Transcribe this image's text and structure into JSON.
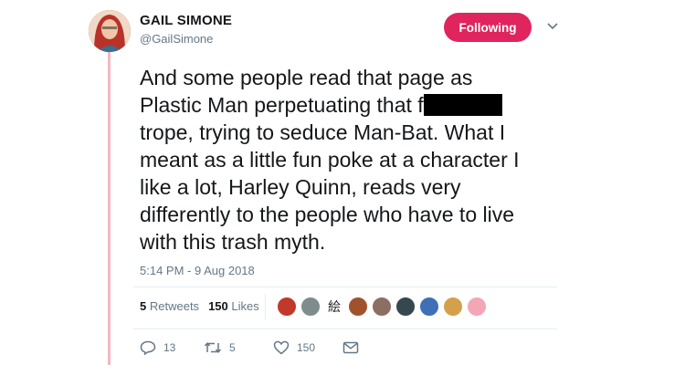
{
  "author": {
    "name": "GAIL SIMONE",
    "handle": "@GailSimone",
    "avatar_icon": "user-avatar"
  },
  "follow_button": {
    "label": "Following",
    "color": "#e0245e"
  },
  "menu_icon": "chevron-down-icon",
  "tweet": {
    "lines": [
      "And some people read that page as",
      "Plastic Man perpetuating that f",
      "trope, trying to seduce Man-Bat. What I",
      "meant as a little fun poke at a character I",
      "like a lot, Harley Quinn, reads very",
      "differently to the people who have to live",
      "with this trash myth."
    ],
    "timestamp": "5:14 PM - 9 Aug 2018"
  },
  "stats": {
    "retweets_count": "5",
    "retweets_label": "Retweets",
    "likes_count": "150",
    "likes_label": "Likes"
  },
  "likers": [
    {
      "icon": "liker-avatar-1",
      "color": "#c0392b"
    },
    {
      "icon": "liker-avatar-2",
      "color": "#7f8c8d"
    },
    {
      "icon": "liker-avatar-3",
      "color": "#ffffff",
      "glyph": "絵"
    },
    {
      "icon": "liker-avatar-4",
      "color": "#a0522d"
    },
    {
      "icon": "liker-avatar-5",
      "color": "#8d6e63"
    },
    {
      "icon": "liker-avatar-6",
      "color": "#37474f"
    },
    {
      "icon": "liker-avatar-7",
      "color": "#3f6fb5"
    },
    {
      "icon": "liker-avatar-8",
      "color": "#d4a04c"
    },
    {
      "icon": "liker-avatar-9",
      "color": "#f3a6b6"
    }
  ],
  "actions": {
    "replies": "13",
    "retweets": "5",
    "likes": "150"
  },
  "colors": {
    "thread_line": "#f2b8c3",
    "muted_text": "#657786",
    "primary_text": "#14171a"
  }
}
